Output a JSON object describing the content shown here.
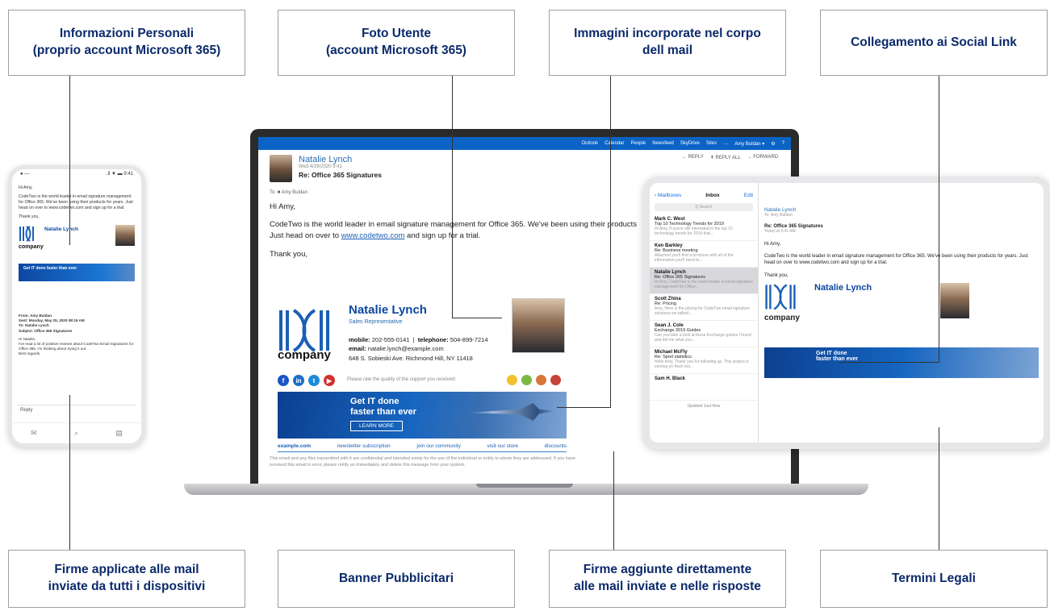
{
  "callouts": {
    "personal_info": "Informazioni Personali\n(proprio account Microsoft 365)",
    "user_photo": "Foto Utente\n(account Microsoft 365)",
    "embedded_images": "Immagini incorporate nel corpo\ndell mail",
    "social_links": "Collegamento ai Social Link",
    "all_devices": "Firme applicate alle mail\ninviate da tutti i dispositivi",
    "ad_banners": "Banner Pubblicitari",
    "direct_signatures": "Firme aggiunte direttamente\nalle mail inviate e nelle risposte",
    "legal_terms": "Termini Legali"
  },
  "laptop": {
    "owa_nav": [
      "Outlook",
      "Calendar",
      "People",
      "Newsfeed",
      "SkyDrive",
      "Sites",
      "…",
      "Amy Buldan ▾",
      "⚙",
      "?"
    ],
    "actions": [
      "← REPLY",
      "⇞ REPLY ALL",
      "→ FORWARD"
    ],
    "sender": "Natalie Lynch",
    "meta": "Wed 4/29/2020 9:41",
    "subject": "Re: Office 365 Signatures",
    "to": "To: ■ Amy Buldan",
    "greeting": "Hi Amy,",
    "body_line1": "CodeTwo is the world leader in email signature management for Office 365. We've been using their products",
    "body_line2_a": "Just head on over to ",
    "body_line2_link": "www.codetwo.com",
    "body_line2_b": " and sign up for a trial.",
    "closing": "Thank you,"
  },
  "signature": {
    "name": "Natalie Lynch",
    "role": "Sales Representative",
    "mobile_label": "mobile:",
    "mobile": "202-555-0141",
    "telephone_label": "telephone:",
    "telephone": "504-899-7214",
    "email_label": "email:",
    "email": "natalie.lynch@example.com",
    "address": "648 S. Sobieski Ave. Richmond Hill, NY 11418",
    "logo_text": "company",
    "rating_text": "Please rate the quality of the support you received:",
    "banner_title_1": "Get IT done",
    "banner_title_2": "faster than ever",
    "banner_button": "LEARN MORE",
    "footer_links": [
      "example.com",
      "newsletter subscription",
      "join our community",
      "visit our store",
      "discounts"
    ],
    "legal": "This email and any files transmitted with it are confidential and intended solely for the use of the individual or entity to whom they are addressed. If you have received this email in error, please notify us immediately and delete this message from your system.",
    "social_colors": [
      "#1a56c8",
      "#1a6fc8",
      "#1a8bd8",
      "#d0312d"
    ],
    "smiley_colors": [
      "#f2c12e",
      "#7bb843",
      "#d8763a",
      "#c8423a"
    ]
  },
  "phone": {
    "status_left": "● —",
    "status_right": "..ll ▼ ▬ 9:41",
    "greeting": "Hi Amy,",
    "body": "CodeTwo is the world leader in email signature management for Office 365. We've been using their products for years. Just head on over to www.codetwo.com and sign up for a trial.",
    "thanks": "Thank you,",
    "sig_name": "Natalie Lynch",
    "logo_text": "company",
    "banner": "Get IT done faster than ever",
    "quoted": "From: Amy Buldan\nSent: Monday, May 25, 2020 08:15 AM\nTo: Natalie Lynch\nSubject: Office 365 Signatures",
    "quoted_body": "Hi Natalie,\nI've read a lot of positive reviews about CodeTwo Email Signatures for Office 365. I'm thinking about trying it out.\nBest regards,",
    "reply": "Reply",
    "tabs": [
      "✉",
      "⌕",
      "▤"
    ]
  },
  "tablet": {
    "mailboxes": "‹ Mailboxes",
    "inbox": "Inbox",
    "edit": "Edit",
    "search": "Q Search",
    "messages": [
      {
        "who": "Mark C. West",
        "sub": "Top 10 Technology Trends for 2019",
        "prev": "Hi Amy, If you're still interested in the top 10 technology trends for 2019 that..."
      },
      {
        "who": "Ken Barkley",
        "sub": "Re: Business meeting",
        "prev": "Attached you'll find a brochure with all of the information you'll need to..."
      },
      {
        "who": "Natalie Lynch",
        "sub": "Re: Office 365 Signatures",
        "prev": "Hi Amy, CodeTwo is the world leader in email signature management for Office..."
      },
      {
        "who": "Scott Zhina",
        "sub": "Re: Pricing",
        "prev": "Amy, Here is the pricing for CodeTwo email signature solutions we talked..."
      },
      {
        "who": "Sean J. Cole",
        "sub": "Exchange 2019 Guides",
        "prev": "Can you take a look at these Exchange guides I found and tell me what you..."
      },
      {
        "who": "Michael McFly",
        "sub": "Re: Sport statistics",
        "prev": "Hello Amy, Thank you for following up. This project is coming on fresh but..."
      },
      {
        "who": "Sam H. Black",
        "sub": "",
        "prev": ""
      }
    ],
    "updated": "Updated Just Now",
    "sender": "Natalie Lynch",
    "to": "To: Amy Buldan",
    "subject": "Re: Office 365 Signatures",
    "time": "Today at 9:41 AM",
    "greeting": "Hi Amy,",
    "body": "CodeTwo is the world leader in email signature management for Office 365. We've been using their products for years. Just head on over to www.codetwo.com and sign up for a trial.",
    "thanks": "Thank you,"
  }
}
